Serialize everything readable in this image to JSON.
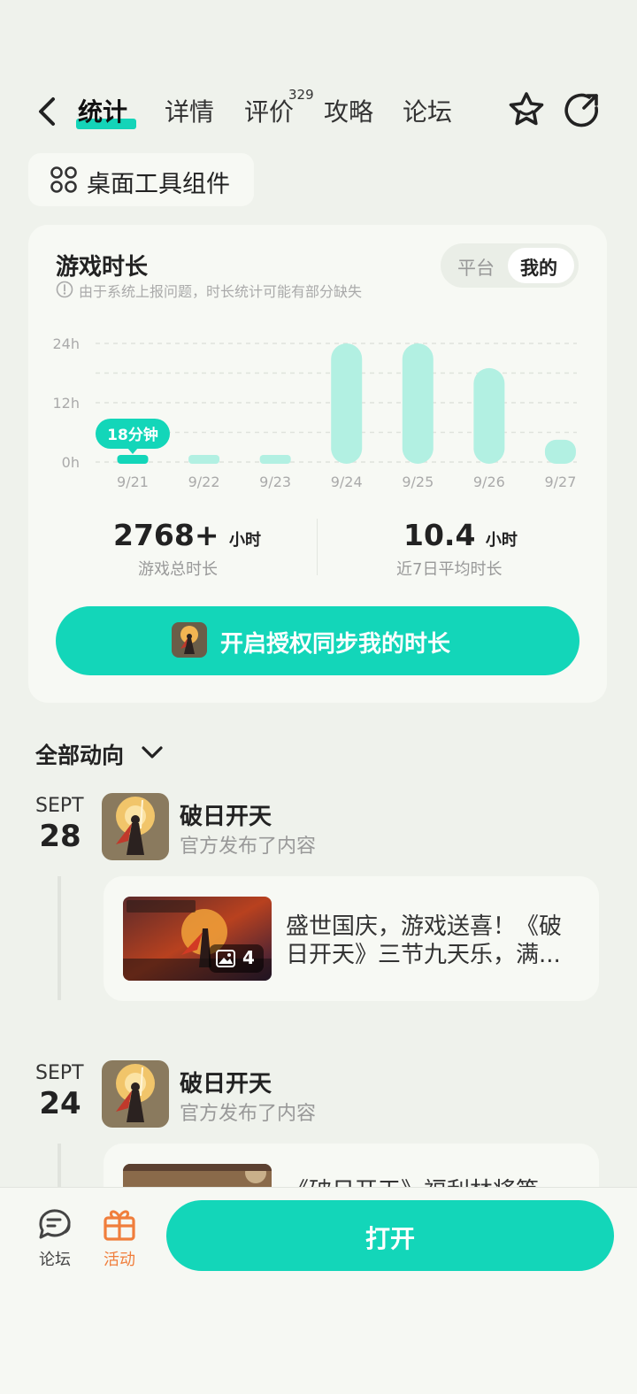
{
  "nav": {
    "tabs": [
      {
        "label": "统计"
      },
      {
        "label": "详情"
      },
      {
        "label": "评价"
      },
      {
        "label": "攻略"
      },
      {
        "label": "论坛"
      }
    ],
    "review_count": "329",
    "icons": [
      "back-icon",
      "star-icon",
      "share-icon"
    ]
  },
  "widget": {
    "label": "桌面工具组件"
  },
  "playtime": {
    "title": "游戏时长",
    "note": "由于系统上报问题，时长统计可能有部分缺失",
    "toggle": {
      "off": "平台",
      "on": "我的"
    },
    "tooltip": "18分钟",
    "stats": [
      {
        "value": "2768",
        "plus": "+",
        "unit": "小时",
        "label": "游戏总时长"
      },
      {
        "value": "10.4",
        "unit": "小时",
        "label": "近7日平均时长"
      }
    ],
    "sync_button": "开启授权同步我的时长"
  },
  "chart_data": {
    "type": "bar",
    "categories": [
      "9/21",
      "9/22",
      "9/23",
      "9/24",
      "9/25",
      "9/26",
      "9/27"
    ],
    "values": [
      0.3,
      0.3,
      0.3,
      24,
      24,
      19,
      4.5
    ],
    "yticks": [
      "0h",
      "12h",
      "24h"
    ],
    "ylim": [
      0,
      24
    ],
    "color": "#b2f0e2",
    "highlight_color": "#13d6b9",
    "grid": true
  },
  "feed": {
    "filter_label": "全部动向",
    "items": [
      {
        "month": "SEPT",
        "day": "28",
        "game": "破日开天",
        "action": "官方发布了内容",
        "post_line1": "盛世国庆，游戏送喜！《破",
        "post_line2": "日开天》三节九天乐，满...",
        "image_count": "4"
      },
      {
        "month": "SEPT",
        "day": "24",
        "game": "破日开天",
        "action": "官方发布了内容",
        "post_line1": "《破日开天》福利林将等一",
        "post_line2": ""
      }
    ]
  },
  "bottom": {
    "forum": "论坛",
    "activity": "活动",
    "open": "打开"
  },
  "colors": {
    "accent": "#13d6b9",
    "activity": "#f07e3c",
    "background": "#eff2ec"
  }
}
